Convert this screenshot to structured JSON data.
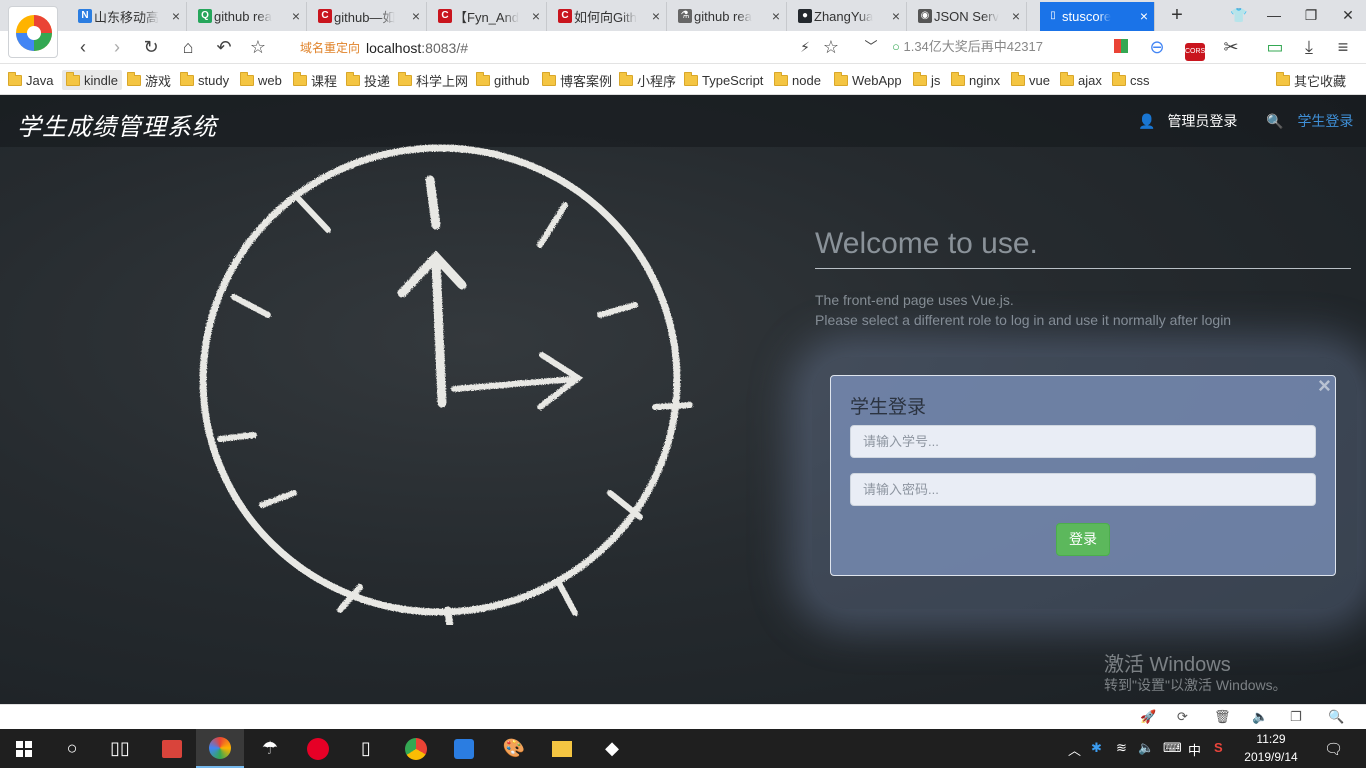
{
  "tabs": [
    {
      "title": "山东移动高",
      "icon": "nk-icon",
      "color": "#2b7de1",
      "glyph": "N"
    },
    {
      "title": "github rea",
      "icon": "search-green-icon",
      "color": "#26a65b",
      "glyph": "Q"
    },
    {
      "title": "github—如",
      "icon": "csdn-icon",
      "color": "#c9151e",
      "glyph": "C"
    },
    {
      "title": "【Fyn_And",
      "icon": "csdn-icon",
      "color": "#c9151e",
      "glyph": "C"
    },
    {
      "title": "如何向Gith",
      "icon": "csdn-icon",
      "color": "#c9151e",
      "glyph": "C"
    },
    {
      "title": "github rea",
      "icon": "repo-icon",
      "color": "#666666",
      "glyph": "⚗"
    },
    {
      "title": "ZhangYua",
      "icon": "github-icon",
      "color": "#24292e",
      "glyph": "●"
    },
    {
      "title": "JSON Serv",
      "icon": "json-icon",
      "color": "#555555",
      "glyph": "◉"
    },
    {
      "title": "stuscore",
      "icon": "page-icon",
      "color": "#ffffff",
      "glyph": "▯",
      "active": true
    }
  ],
  "toolbar": {
    "redirect_label": "域名重定向",
    "url_host": "localhost",
    "url_rest": ":8083/#",
    "hot_search": "1.34亿大奖后再中42317"
  },
  "bookmarks": [
    "Java",
    "kindle",
    "游戏",
    "study",
    "web",
    "课程",
    "投递",
    "科学上网",
    "github",
    "博客案例",
    "小程序",
    "TypeScript",
    "node",
    "WebApp",
    "js",
    "nginx",
    "vue",
    "ajax",
    "css"
  ],
  "bookmarks_other": "其它收藏",
  "app": {
    "brand": "学生成绩管理系统",
    "nav_admin": "管理员登录",
    "nav_student": "学生登录",
    "welcome": "Welcome to use.",
    "desc_line1": "The front-end page uses Vue.js.",
    "desc_line2": "Please select a different role to log in and use it normally after login"
  },
  "login": {
    "title": "学生登录",
    "close": "×",
    "student_id_placeholder": "请输入学号...",
    "password_placeholder": "请输入密码...",
    "submit_label": "登录"
  },
  "watermark": {
    "line1": "激活 Windows",
    "line2": "转到\"设置\"以激活 Windows。"
  },
  "taskbar": {
    "time": "11:29",
    "date": "2019/9/14",
    "ime": "中"
  },
  "colors": {
    "active_tab": "#1a73e8",
    "student_link": "#3f8fd6",
    "login_button": "#5cb85c"
  }
}
